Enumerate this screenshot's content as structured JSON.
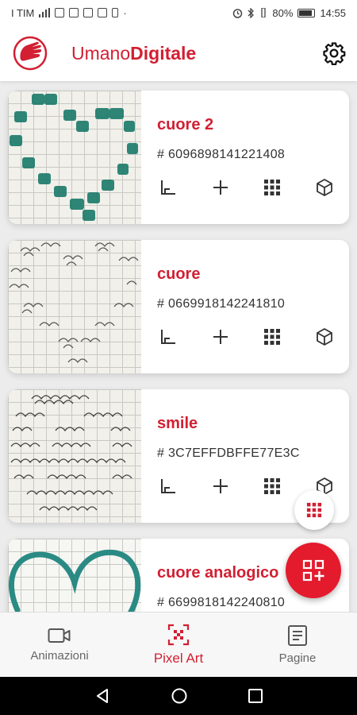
{
  "status_bar": {
    "carrier": "I TIM",
    "battery": "80%",
    "time": "14:55"
  },
  "app_bar": {
    "brand_light": "Umano",
    "brand_bold": "Digitale",
    "settings_icon": "gear-icon"
  },
  "cards": [
    {
      "title": "cuore 2",
      "code": "# 6096898141221408",
      "thumbnail": "green-marker-heart"
    },
    {
      "title": "cuore",
      "code": "# 0669918142241810",
      "thumbnail": "pencil-heart"
    },
    {
      "title": "smile",
      "code": "# 3C7EFFDBFFE77E3C",
      "thumbnail": "pencil-smile"
    },
    {
      "title": "cuore analogico",
      "code": "# 6699818142240810",
      "thumbnail": "teal-outline-heart"
    }
  ],
  "card_actions": [
    "axis-icon",
    "plus-icon",
    "grid-icon",
    "cube-icon"
  ],
  "fabs": {
    "mini": "grid-icon",
    "main": "qr-add-icon"
  },
  "bottom_nav": {
    "items": [
      {
        "label": "Animazioni",
        "icon": "video-icon",
        "active": false
      },
      {
        "label": "Pixel Art",
        "icon": "pixel-art-icon",
        "active": true
      },
      {
        "label": "Pagine",
        "icon": "page-icon",
        "active": false
      }
    ]
  },
  "colors": {
    "accent": "#d21f32",
    "fab": "#e31b2d",
    "background": "#ececec"
  }
}
